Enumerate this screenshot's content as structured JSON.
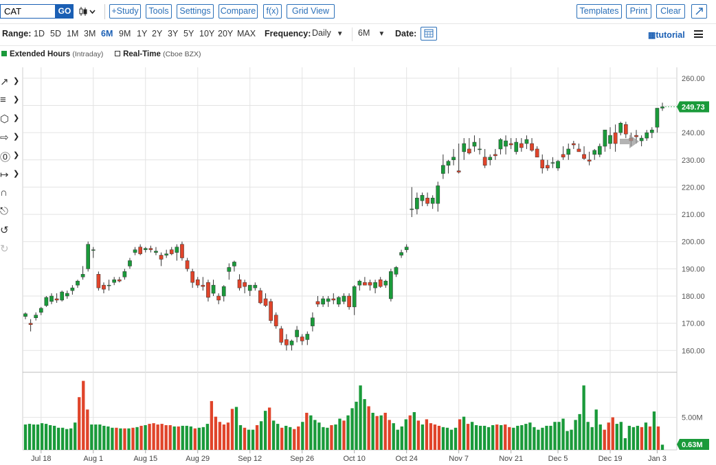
{
  "toolbar": {
    "symbol": "CAT",
    "go_label": "GO",
    "chart_type_icon": "candlestick-icon",
    "buttons": [
      "+Study",
      "Tools",
      "Settings",
      "Compare",
      "f(x)",
      "Grid View"
    ],
    "right_buttons": [
      "Templates",
      "Print",
      "Clear"
    ],
    "expand_icon": "expand-arrow-icon"
  },
  "range_bar": {
    "range_label": "Range:",
    "ranges": [
      "1D",
      "5D",
      "1M",
      "3M",
      "6M",
      "9M",
      "1Y",
      "2Y",
      "3Y",
      "5Y",
      "10Y",
      "20Y",
      "MAX"
    ],
    "active_range": "6M",
    "frequency_label": "Frequency:",
    "frequency_value": "Daily",
    "period_value": "6M",
    "date_label": "Date:",
    "tutorial_label": "tutorial"
  },
  "legend": {
    "extended_label": "Extended Hours",
    "extended_sub": "(Intraday)",
    "realtime_label": "Real-Time",
    "realtime_sub": "(Cboe BZX)"
  },
  "left_tools": [
    "line-tool-icon",
    "fib-tool-icon",
    "shape-tool-icon",
    "arrow-tool-icon",
    "text-tool-icon",
    "measure-tool-icon",
    "magnet-icon",
    "lock-icon",
    "undo-icon",
    "redo-icon"
  ],
  "colors": {
    "up": "#1a9a3a",
    "down": "#e0442a",
    "accent": "#1a5fb4",
    "last_price_bg": "#1a9a3a"
  },
  "chart_data": [
    {
      "type": "candlestick",
      "y_ticks": [
        "260.00",
        "250.00",
        "240.00",
        "230.00",
        "220.00",
        "210.00",
        "200.00",
        "190.00",
        "180.00",
        "170.00",
        "160.00"
      ],
      "ylim": [
        152,
        264
      ],
      "x_ticks": [
        {
          "label": "Jul 18",
          "i": 3
        },
        {
          "label": "Aug 1",
          "i": 13
        },
        {
          "label": "Aug 15",
          "i": 23
        },
        {
          "label": "Aug 29",
          "i": 33
        },
        {
          "label": "Sep 12",
          "i": 43
        },
        {
          "label": "Sep 26",
          "i": 53
        },
        {
          "label": "Oct 10",
          "i": 63
        },
        {
          "label": "Oct 24",
          "i": 73
        },
        {
          "label": "Nov 7",
          "i": 83
        },
        {
          "label": "Nov 21",
          "i": 93
        },
        {
          "label": "Dec 5",
          "i": 102
        },
        {
          "label": "Dec 19",
          "i": 112
        },
        {
          "label": "Jan 3",
          "i": 121
        }
      ],
      "last_price": "249.73",
      "candles": [
        [
          172.5,
          174,
          171.5,
          173.5
        ],
        [
          170,
          171.5,
          167,
          169.5
        ],
        [
          172,
          174,
          171,
          173
        ],
        [
          174,
          176,
          173,
          175.5
        ],
        [
          176.5,
          180,
          176,
          179.5
        ],
        [
          178,
          181,
          177,
          180
        ],
        [
          179,
          181,
          177.5,
          178.5
        ],
        [
          178.5,
          182,
          178,
          181.5
        ],
        [
          180,
          182,
          179,
          181
        ],
        [
          182,
          184,
          180.5,
          183
        ],
        [
          184,
          186,
          183,
          185.5
        ],
        [
          187,
          191,
          186,
          188
        ],
        [
          190,
          200,
          189,
          199
        ],
        [
          197,
          198,
          194,
          197
        ],
        [
          188,
          189,
          182,
          183
        ],
        [
          184,
          185,
          181,
          182.5
        ],
        [
          184,
          186,
          182,
          184
        ],
        [
          185,
          187,
          184,
          186
        ],
        [
          186,
          187,
          185,
          185.5
        ],
        [
          187,
          190,
          186,
          189
        ],
        [
          191,
          194,
          190,
          193
        ],
        [
          196,
          198,
          195,
          197
        ],
        [
          198,
          199,
          195,
          195.5
        ],
        [
          197,
          198,
          196,
          197.5
        ],
        [
          197.5,
          198.5,
          196,
          197
        ],
        [
          196,
          198,
          195,
          196.5
        ],
        [
          195,
          196,
          191,
          193.5
        ],
        [
          195,
          197,
          194,
          195.5
        ],
        [
          197,
          198,
          195,
          195.5
        ],
        [
          196,
          199,
          193,
          198
        ],
        [
          199,
          200,
          193,
          194
        ],
        [
          193,
          194,
          189,
          190
        ],
        [
          189,
          190,
          183,
          185
        ],
        [
          186,
          187,
          183,
          184
        ],
        [
          184,
          187,
          182,
          183.5
        ],
        [
          185,
          186,
          178,
          179.5
        ],
        [
          181,
          186,
          180,
          184
        ],
        [
          180,
          181,
          177,
          178.5
        ],
        [
          180,
          184,
          178,
          183.5
        ],
        [
          189,
          192,
          186,
          190.5
        ],
        [
          191,
          193,
          189,
          192.5
        ],
        [
          186,
          188,
          182,
          183
        ],
        [
          185,
          186,
          181,
          183.5
        ],
        [
          182,
          184,
          180,
          184
        ],
        [
          183,
          185,
          182,
          184
        ],
        [
          182,
          183,
          177,
          177.5
        ],
        [
          179,
          181,
          176,
          176.5
        ],
        [
          178,
          179,
          170,
          171
        ],
        [
          173,
          174,
          168,
          169
        ],
        [
          168,
          169,
          162,
          163
        ],
        [
          164,
          166,
          160,
          162
        ],
        [
          162,
          164,
          160,
          163.5
        ],
        [
          165,
          169,
          163,
          167.5
        ],
        [
          165,
          166,
          162,
          163.5
        ],
        [
          164,
          167,
          162,
          166
        ],
        [
          169,
          174,
          167,
          172
        ],
        [
          178,
          180,
          176,
          177
        ],
        [
          177,
          180,
          176,
          179
        ],
        [
          178,
          180,
          176,
          179
        ],
        [
          179,
          181,
          177,
          178.5
        ],
        [
          177,
          180,
          176,
          179.5
        ],
        [
          178,
          181,
          177,
          180
        ],
        [
          180,
          181,
          175,
          176
        ],
        [
          176,
          184,
          173,
          183.5
        ],
        [
          184,
          186,
          182,
          185.5
        ],
        [
          185,
          187,
          184,
          184
        ],
        [
          185,
          186,
          182,
          184
        ],
        [
          183,
          186,
          181,
          185
        ],
        [
          186,
          187,
          183,
          183.5
        ],
        [
          184,
          186,
          183,
          185.5
        ],
        [
          179,
          190,
          178,
          189
        ],
        [
          188,
          191,
          187,
          190.5
        ],
        [
          195,
          197,
          194,
          196
        ],
        [
          197,
          199,
          196,
          198
        ],
        [
          212,
          220,
          209,
          212
        ],
        [
          212,
          218,
          210,
          216
        ],
        [
          215,
          218,
          213,
          217
        ],
        [
          216,
          218,
          213,
          214
        ],
        [
          214,
          217,
          212,
          216
        ],
        [
          214,
          222,
          211,
          220.5
        ],
        [
          225,
          232,
          223,
          228
        ],
        [
          228,
          230,
          225,
          229.5
        ],
        [
          230,
          234,
          228,
          231
        ],
        [
          226,
          236,
          225,
          225.5
        ],
        [
          233,
          238,
          230,
          236
        ],
        [
          234,
          238,
          232,
          232.5
        ],
        [
          235,
          239,
          233,
          236.5
        ],
        [
          234,
          238,
          232,
          234
        ],
        [
          231,
          234,
          227,
          228
        ],
        [
          230,
          232,
          228,
          231
        ],
        [
          232,
          234,
          230,
          231.5
        ],
        [
          234,
          238,
          232,
          237.5
        ],
        [
          235,
          239,
          232,
          237
        ],
        [
          236,
          238,
          234,
          235.5
        ],
        [
          233,
          238,
          232,
          236.5
        ],
        [
          236,
          238,
          233,
          234.5
        ],
        [
          236,
          239,
          234,
          237.5
        ],
        [
          236,
          238,
          233,
          233.5
        ],
        [
          234,
          235,
          231,
          231
        ],
        [
          230,
          232,
          225,
          227
        ],
        [
          228,
          230,
          226,
          227
        ],
        [
          229,
          231,
          227,
          229
        ],
        [
          227,
          230,
          226,
          229.5
        ],
        [
          232,
          235,
          230,
          231
        ],
        [
          232,
          236,
          230,
          234
        ],
        [
          236,
          237,
          234,
          235.5
        ],
        [
          234,
          236,
          233,
          233
        ],
        [
          232,
          235,
          230,
          230.5
        ],
        [
          230,
          233,
          228,
          229.5
        ],
        [
          232,
          234,
          230,
          233.5
        ],
        [
          232,
          236,
          231,
          235
        ],
        [
          235,
          240,
          233,
          241
        ],
        [
          236,
          242,
          234,
          239
        ],
        [
          240,
          243,
          233,
          236
        ],
        [
          240,
          244,
          239,
          243.5
        ],
        [
          243,
          244,
          238,
          239.5
        ],
        [
          238,
          240,
          235,
          237
        ],
        [
          239,
          241,
          236,
          238.5
        ],
        [
          237,
          239,
          235,
          238
        ],
        [
          238,
          241,
          237,
          240
        ],
        [
          240,
          242,
          238,
          241
        ],
        [
          242,
          249,
          240,
          249
        ],
        [
          249,
          251,
          248,
          249.5
        ]
      ]
    },
    {
      "type": "bar",
      "series_name": "Volume",
      "y_ticks": [
        "5.00M"
      ],
      "ylim": [
        0,
        11.5
      ],
      "last_volume": "0.63M",
      "values": [
        3.9,
        4.0,
        3.9,
        3.9,
        4.1,
        4.0,
        3.8,
        3.7,
        3.4,
        3.4,
        3.2,
        3.3,
        4.2,
        8.1,
        10.6,
        6.2,
        3.9,
        3.9,
        3.9,
        3.7,
        3.6,
        3.4,
        3.4,
        3.3,
        3.3,
        3.3,
        3.4,
        3.5,
        3.7,
        3.8,
        4.0,
        4.1,
        3.9,
        4.0,
        3.8,
        3.8,
        3.6,
        3.6,
        3.7,
        3.7,
        3.6,
        3.3,
        3.4,
        3.5,
        4.0,
        7.5,
        5.1,
        4.3,
        3.9,
        4.2,
        6.3,
        6.6,
        3.8,
        3.4,
        3.1,
        3.1,
        3.8,
        4.4,
        6.0,
        6.5,
        4.5,
        4.0,
        3.4,
        3.7,
        3.5,
        3.2,
        3.6,
        4.3,
        5.7,
        5.3,
        4.6,
        4.2,
        3.5,
        3.4,
        3.8,
        3.9,
        4.8,
        4.5,
        5.3,
        6.4,
        7.4,
        9.9,
        7.8,
        6.7,
        5.7,
        5.2,
        5.3,
        5.7,
        4.6,
        4.1,
        3.1,
        3.6,
        4.7,
        5.3,
        5.8,
        4.5,
        3.9,
        4.7,
        4.1,
        3.9,
        3.7,
        3.5,
        3.4,
        3.1,
        3.4,
        4.7,
        5.1,
        4.0,
        4.3,
        3.8,
        3.7,
        3.7,
        3.5,
        3.8,
        3.9,
        3.8,
        3.9,
        3.5,
        3.4,
        3.7,
        3.8,
        4.0,
        4.2,
        3.5,
        3.1,
        3.4,
        3.7,
        3.7,
        4.3,
        4.3,
        4.8,
        2.9,
        3.1,
        4.6,
        5.5,
        9.9,
        4.3,
        3.5,
        6.2,
        3.9,
        3.1,
        4.2,
        5.0,
        4.0,
        4.3,
        1.8,
        3.7,
        3.5,
        3.7,
        3.5,
        4.2,
        3.6,
        5.9,
        3.6,
        0.8
      ],
      "colors_up": [
        1,
        1,
        1,
        1,
        1,
        1,
        1,
        1,
        1,
        1,
        1,
        1,
        1,
        0,
        0,
        0,
        1,
        1,
        1,
        1,
        1,
        1,
        0,
        1,
        0,
        1,
        0,
        1,
        0,
        1,
        0,
        0,
        0,
        0,
        0,
        0,
        1,
        0,
        1,
        1,
        1,
        0,
        1,
        1,
        1,
        0,
        0,
        0,
        0,
        0,
        0,
        1,
        1,
        0,
        1,
        1,
        0,
        1,
        1,
        0,
        1,
        1,
        0,
        1,
        1,
        0,
        0,
        1,
        0,
        1,
        1,
        1,
        1,
        1,
        0,
        1,
        1,
        0,
        1,
        1,
        1,
        1,
        1,
        0,
        1,
        0,
        1,
        0,
        0,
        1,
        1,
        1,
        1,
        0,
        1,
        0,
        1,
        0,
        0,
        0,
        0,
        1,
        1,
        1,
        1,
        0,
        1,
        0,
        1,
        1,
        1,
        1,
        1,
        1,
        0,
        1,
        0,
        0,
        1,
        1,
        1,
        1,
        1,
        1,
        1,
        1,
        1
      ]
    }
  ]
}
